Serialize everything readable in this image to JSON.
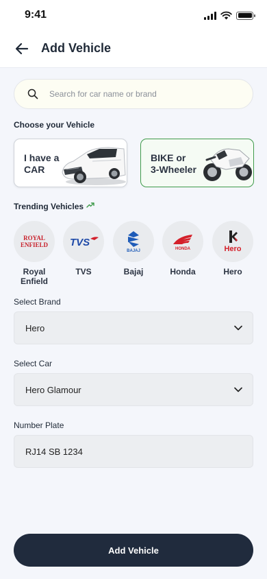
{
  "status": {
    "time": "9:41"
  },
  "header": {
    "title": "Add Vehicle"
  },
  "search": {
    "placeholder": "Search for car name or brand"
  },
  "choose": {
    "label": "Choose your Vehicle",
    "options": [
      {
        "label": "I have a\nCAR",
        "selected": false
      },
      {
        "label": "BIKE or\n3-Wheeler",
        "selected": true
      }
    ]
  },
  "trending": {
    "label": "Trending Vehicles",
    "brands": [
      {
        "name": "Royal\nEnfield",
        "logo_text": "ROYAL ENFIELD"
      },
      {
        "name": "TVS",
        "logo_text": "TVS"
      },
      {
        "name": "Bajaj",
        "logo_text": "BAJAJ"
      },
      {
        "name": "Honda",
        "logo_text": "HONDA"
      },
      {
        "name": "Hero",
        "logo_text": "Hero"
      }
    ]
  },
  "form": {
    "brand_label": "Select Brand",
    "brand_value": "Hero",
    "car_label": "Select Car",
    "car_value": "Hero Glamour",
    "plate_label": "Number Plate",
    "plate_value": "RJ14 SB 1234"
  },
  "action": {
    "add_label": "Add Vehicle"
  },
  "colors": {
    "primary": "#202b3d",
    "selected_border": "#3e9a4a",
    "background": "#f4f6fb",
    "trend_icon": "#3e9a4a"
  }
}
